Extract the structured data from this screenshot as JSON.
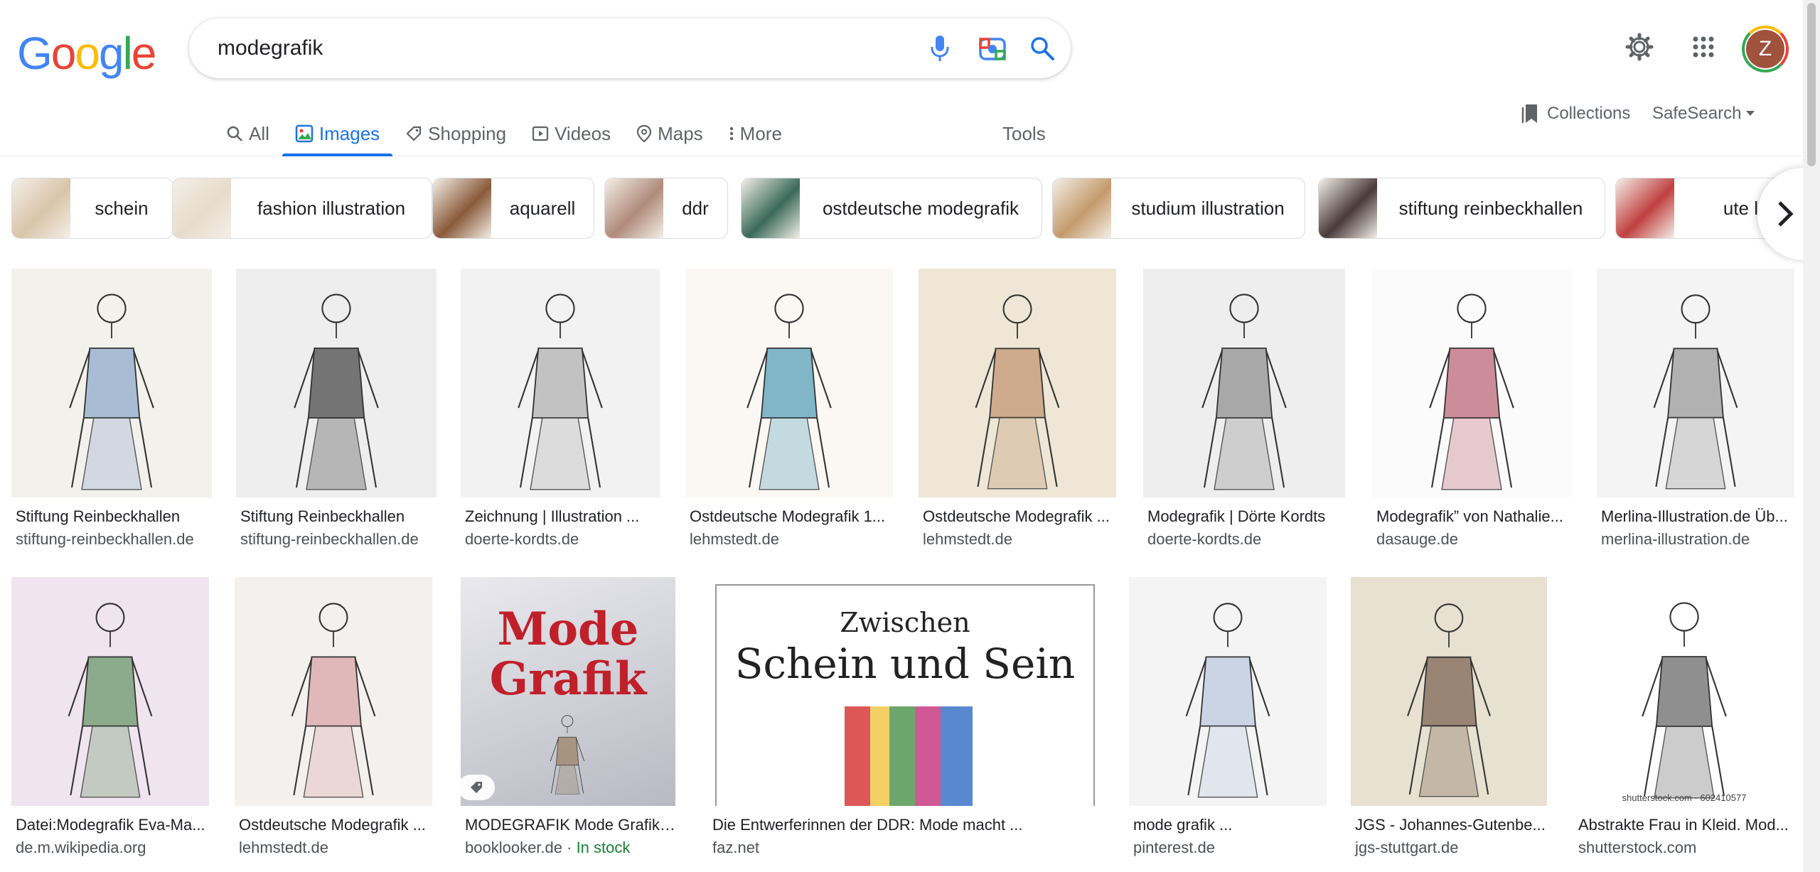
{
  "logo": {
    "letters": [
      "G",
      "o",
      "o",
      "g",
      "l",
      "e"
    ],
    "colors": [
      "#4285F4",
      "#EA4335",
      "#FBBC05",
      "#4285F4",
      "#34A853",
      "#EA4335"
    ]
  },
  "search": {
    "query": "modegrafik"
  },
  "tabs": [
    {
      "label": "All",
      "icon": "search-icon"
    },
    {
      "label": "Images",
      "icon": "image-icon",
      "active": true
    },
    {
      "label": "Shopping",
      "icon": "tag-icon"
    },
    {
      "label": "Videos",
      "icon": "play-icon"
    },
    {
      "label": "Maps",
      "icon": "map-pin-icon"
    },
    {
      "label": "More",
      "icon": "more-vert-icon"
    }
  ],
  "tools_label": "Tools",
  "collections_label": "Collections",
  "safesearch_label": "SafeSearch",
  "avatar_letter": "Z",
  "chips": [
    {
      "label": "schein",
      "color": "#d9c4a8"
    },
    {
      "label": "fashion illustration",
      "color": "#e8dccb"
    },
    {
      "label": "aquarell",
      "color": "#8a5a3a"
    },
    {
      "label": "ddr",
      "color": "#b08a7a"
    },
    {
      "label": "ostdeutsche modegrafik",
      "color": "#3a6a5a"
    },
    {
      "label": "studium illustration",
      "color": "#c49a6c"
    },
    {
      "label": "stiftung reinbeckhallen",
      "color": "#4a3a3a"
    },
    {
      "label": "ute lindn",
      "color": "#c04040"
    }
  ],
  "results_row1": [
    {
      "title": "Stiftung Reinbeckhallen",
      "site": "stiftung-reinbeckhallen.de",
      "bg": "#f3f1ec",
      "accent": "#6a8fc0"
    },
    {
      "title": "Stiftung Reinbeckhallen",
      "site": "stiftung-reinbeckhallen.de",
      "bg": "#eeeeee",
      "accent": "#111111"
    },
    {
      "title": "Zeichnung | Illustration ...",
      "site": "doerte-kordts.de",
      "bg": "#f2f2f2",
      "accent": "#9a9a9a"
    },
    {
      "title": "Ostdeutsche Modegrafik 1...",
      "site": "lehmstedt.de",
      "bg": "#fbf8f4",
      "accent": "#1d7fa6"
    },
    {
      "title": "Ostdeutsche Modegrafik ...",
      "site": "lehmstedt.de",
      "bg": "#efe6d6",
      "accent": "#b07a50"
    },
    {
      "title": "Modegrafik | Dörte Kordts",
      "site": "doerte-kordts.de",
      "bg": "#eeeeee",
      "accent": "#6f6f6f"
    },
    {
      "title": "Modegrafik” von Nathalie...",
      "site": "dasauge.de",
      "bg": "#fbfbfb",
      "accent": "#a8324a"
    },
    {
      "title": "Merlina-Illustration.de Üb...",
      "site": "merlina-illustration.de",
      "bg": "#f4f4f4",
      "accent": "#7a7a7a"
    }
  ],
  "results_row2": [
    {
      "title": "Datei:Modegrafik Eva-Ma...",
      "site": "de.m.wikipedia.org",
      "bg": "#efe4ef",
      "accent": "#3a7a3a"
    },
    {
      "title": "Ostdeutsche Modegrafik ...",
      "site": "lehmstedt.de",
      "bg": "#f4f0ee",
      "accent": "#d08a90"
    },
    {
      "title": "MODEGRAFIK Mode Grafik) e...",
      "site": "booklooker.de",
      "stock": "In stock",
      "bg": "#dcdce4",
      "accent": "#c0202a",
      "cover_line1": "Mode",
      "cover_line2": "Grafik"
    },
    {
      "title": "Die Entwerferinnen der DDR: Mode macht ...",
      "site": "faz.net",
      "bg": "#ffffff",
      "accent": "#c02020",
      "headline_small": "Zwischen",
      "headline_big": "Schein und Sein"
    },
    {
      "title": "mode grafik ...",
      "site": "pinterest.de",
      "bg": "#f4f4f4",
      "accent": "#a9b9d9"
    },
    {
      "title": "JGS - Johannes-Gutenbe...",
      "site": "jgs-stuttgart.de",
      "bg": "#e8e0d0",
      "accent": "#5a3a2a"
    },
    {
      "title": "Abstrakte Frau in Kleid. Mod...",
      "site": "shutterstock.com",
      "bg": "#ffffff",
      "accent": "#333333",
      "watermark": "shutterstock.com · 602410577"
    }
  ]
}
